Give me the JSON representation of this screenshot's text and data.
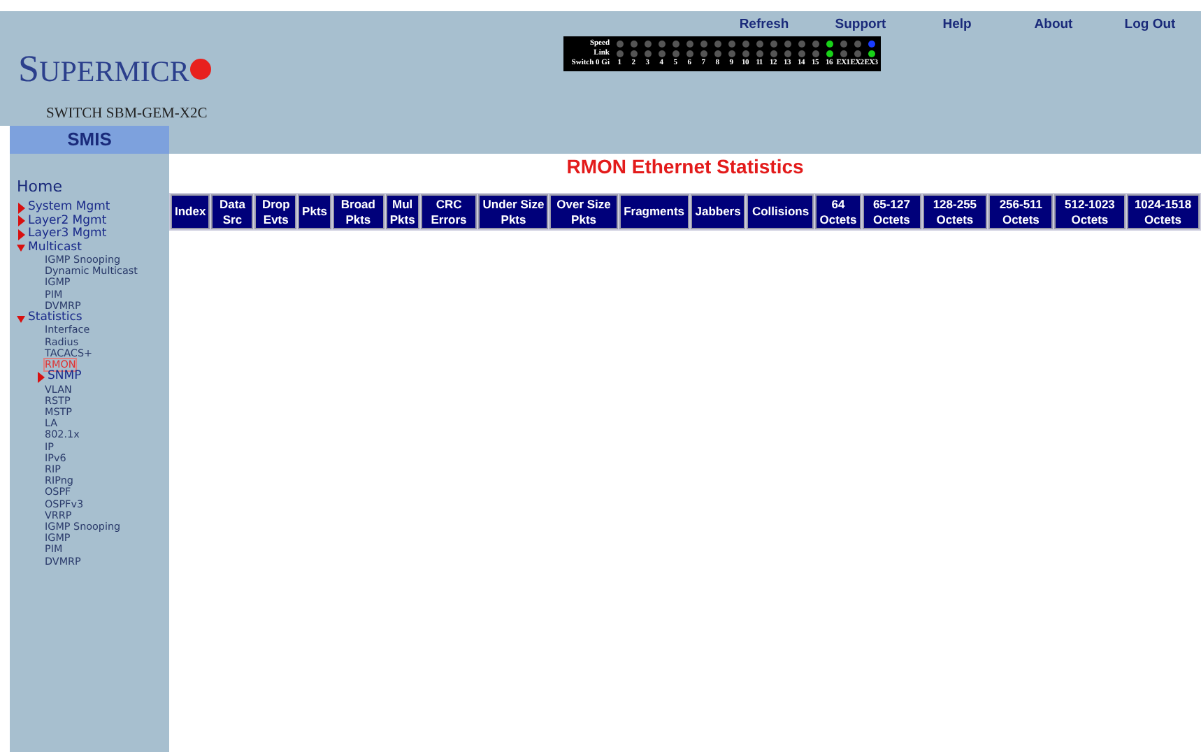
{
  "top_links": [
    "Refresh",
    "Support",
    "Help",
    "About",
    "Log Out"
  ],
  "brand": {
    "logo": "SUPERMICR",
    "model": "SWITCH SBM-GEM-X2C"
  },
  "port_panel": {
    "speed_label": "Speed",
    "link_label": "Link",
    "switch_label": "Switch 0 Gi",
    "ports": [
      {
        "label": "1",
        "speed": {
          "color": "#555555"
        },
        "link": {
          "color": "#555555"
        }
      },
      {
        "label": "2",
        "speed": {
          "color": "#555555"
        },
        "link": {
          "color": "#555555"
        }
      },
      {
        "label": "3",
        "speed": {
          "color": "#555555"
        },
        "link": {
          "color": "#555555"
        }
      },
      {
        "label": "4",
        "speed": {
          "color": "#555555"
        },
        "link": {
          "color": "#555555"
        }
      },
      {
        "label": "5",
        "speed": {
          "color": "#555555"
        },
        "link": {
          "color": "#555555"
        }
      },
      {
        "label": "6",
        "speed": {
          "color": "#555555"
        },
        "link": {
          "color": "#555555"
        }
      },
      {
        "label": "7",
        "speed": {
          "color": "#555555"
        },
        "link": {
          "color": "#555555"
        }
      },
      {
        "label": "8",
        "speed": {
          "color": "#555555"
        },
        "link": {
          "color": "#555555"
        }
      },
      {
        "label": "9",
        "speed": {
          "color": "#555555"
        },
        "link": {
          "color": "#555555"
        }
      },
      {
        "label": "10",
        "speed": {
          "color": "#555555"
        },
        "link": {
          "color": "#555555"
        }
      },
      {
        "label": "11",
        "speed": {
          "color": "#555555"
        },
        "link": {
          "color": "#555555"
        }
      },
      {
        "label": "12",
        "speed": {
          "color": "#555555"
        },
        "link": {
          "color": "#555555"
        }
      },
      {
        "label": "13",
        "speed": {
          "color": "#555555"
        },
        "link": {
          "color": "#555555"
        }
      },
      {
        "label": "14",
        "speed": {
          "color": "#555555"
        },
        "link": {
          "color": "#555555"
        }
      },
      {
        "label": "15",
        "speed": {
          "color": "#555555"
        },
        "link": {
          "color": "#555555"
        }
      },
      {
        "label": "16",
        "speed": {
          "color": "#19d219"
        },
        "link": {
          "color": "#19d219"
        }
      },
      {
        "label": "EX1",
        "speed": {
          "color": "#555555"
        },
        "link": {
          "color": "#555555"
        }
      },
      {
        "label": "EX2",
        "speed": {
          "color": "#555555"
        },
        "link": {
          "color": "#555555"
        }
      },
      {
        "label": "EX3",
        "speed": {
          "color": "#1a3cff"
        },
        "link": {
          "color": "#19d219"
        }
      }
    ]
  },
  "sidebar": {
    "title": "SMIS",
    "home": "Home",
    "items": [
      {
        "label": "System Mgmt",
        "expanded": false
      },
      {
        "label": "Layer2 Mgmt",
        "expanded": false
      },
      {
        "label": "Layer3 Mgmt",
        "expanded": false
      },
      {
        "label": "Multicast",
        "expanded": true,
        "children": [
          {
            "label": "IGMP Snooping",
            "selected": false
          },
          {
            "label": "Dynamic Multicast",
            "selected": false
          },
          {
            "label": "IGMP",
            "selected": false
          },
          {
            "label": "PIM",
            "selected": false
          },
          {
            "label": "DVMRP",
            "selected": false
          }
        ]
      },
      {
        "label": "Statistics",
        "expanded": true,
        "children": [
          {
            "label": "Interface",
            "selected": false
          },
          {
            "label": "Radius",
            "selected": false
          },
          {
            "label": "TACACS+",
            "selected": false
          },
          {
            "label": "RMON",
            "selected": true
          },
          {
            "label": "SNMP",
            "selected": false,
            "expanded": false
          },
          {
            "label": "VLAN",
            "selected": false
          },
          {
            "label": "RSTP",
            "selected": false
          },
          {
            "label": "MSTP",
            "selected": false
          },
          {
            "label": "LA",
            "selected": false
          },
          {
            "label": "802.1x",
            "selected": false
          },
          {
            "label": "IP",
            "selected": false
          },
          {
            "label": "IPv6",
            "selected": false
          },
          {
            "label": "RIP",
            "selected": false
          },
          {
            "label": "RIPng",
            "selected": false
          },
          {
            "label": "OSPF",
            "selected": false
          },
          {
            "label": "OSPFv3",
            "selected": false
          },
          {
            "label": "VRRP",
            "selected": false
          },
          {
            "label": "IGMP Snooping",
            "selected": false
          },
          {
            "label": "IGMP",
            "selected": false
          },
          {
            "label": "PIM",
            "selected": false
          },
          {
            "label": "DVMRP",
            "selected": false
          }
        ]
      }
    ]
  },
  "page_title": "RMON Ethernet Statistics",
  "table": {
    "columns": [
      "Index",
      "Data Src",
      "Drop Evts",
      "Pkts",
      "Broad Pkts",
      "Mul Pkts",
      "CRC Errors",
      "Under Size Pkts",
      "Over Size Pkts",
      "Fragments",
      "Jabbers",
      "Collisions",
      "64 Octets",
      "65-127 Octets",
      "128-255 Octets",
      "256-511 Octets",
      "512-1023 Octets",
      "1024-1518 Octets"
    ]
  }
}
